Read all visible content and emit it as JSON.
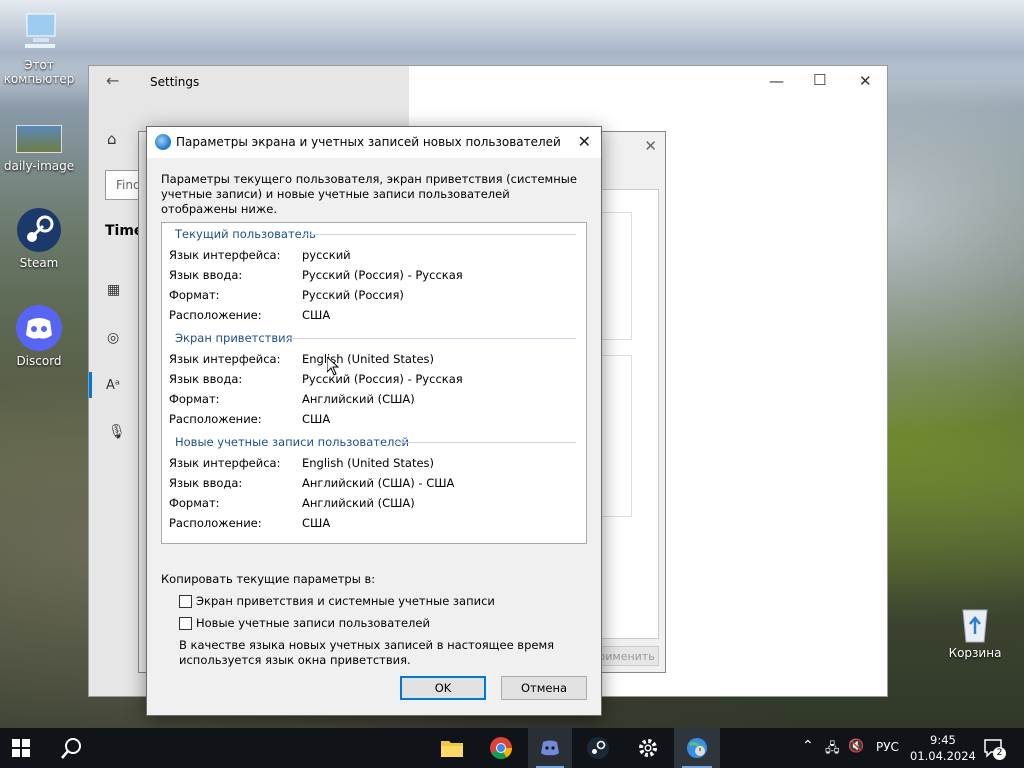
{
  "desktop": {
    "icons": [
      {
        "label": "Этот компьютер"
      },
      {
        "label": "daily-image"
      },
      {
        "label": "Steam"
      },
      {
        "label": "Discord"
      },
      {
        "label": "Корзина"
      }
    ]
  },
  "settings_window": {
    "title": "Settings",
    "search_placeholder": "Find",
    "section_heading": "Time",
    "apply_button": "Применить"
  },
  "dialog": {
    "title": "Параметры экрана и учетных записей новых пользователей",
    "description": "Параметры текущего пользователя, экран приветствия (системные учетные записи) и новые учетные записи пользователей отображены ниже.",
    "groups": [
      {
        "heading": "Текущий пользователь",
        "rows": [
          {
            "key": "Язык интерфейса:",
            "value": "русский"
          },
          {
            "key": "Язык ввода:",
            "value": "Русский (Россия) - Русская"
          },
          {
            "key": "Формат:",
            "value": "Русский (Россия)"
          },
          {
            "key": "Расположение:",
            "value": "США"
          }
        ]
      },
      {
        "heading": "Экран приветствия",
        "rows": [
          {
            "key": "Язык интерфейса:",
            "value": "English (United States)"
          },
          {
            "key": "Язык ввода:",
            "value": "Русский (Россия) - Русская"
          },
          {
            "key": "Формат:",
            "value": "Английский (США)"
          },
          {
            "key": "Расположение:",
            "value": "США"
          }
        ]
      },
      {
        "heading": "Новые учетные записи пользователей",
        "rows": [
          {
            "key": "Язык интерфейса:",
            "value": "English (United States)"
          },
          {
            "key": "Язык ввода:",
            "value": "Английский (США) - США"
          },
          {
            "key": "Формат:",
            "value": "Английский (США)"
          },
          {
            "key": "Расположение:",
            "value": "США"
          }
        ]
      }
    ],
    "copy_label": "Копировать текущие параметры в:",
    "checkbox_welcome": "Экран приветствия и системные учетные записи",
    "checkbox_new_users": "Новые учетные записи пользователей",
    "note": "В качестве языка новых учетных записей в настоящее время используется язык окна приветствия.",
    "ok_button": "OK",
    "cancel_button": "Отмена"
  },
  "taskbar": {
    "language": "РУС",
    "time": "9:45",
    "date": "01.04.2024",
    "notification_count": "2"
  }
}
